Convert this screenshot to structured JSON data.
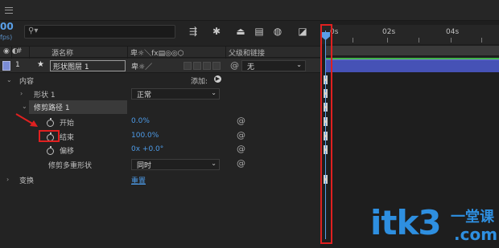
{
  "time": {
    "timecode": "00",
    "fps": "fps)"
  },
  "search": {
    "placeholder": ""
  },
  "header": {
    "col_number": "#",
    "col_source": "源名称",
    "col_parent": "父级和链接"
  },
  "layer": {
    "index": "1",
    "name": "形状图层 1",
    "parent": "无"
  },
  "properties": {
    "contents": "内容",
    "add_label": "添加:",
    "shape": "形状 1",
    "shape_mode": "正常",
    "trim_paths": "修剪路径 1",
    "start_label": "开始",
    "start_value": "0.0%",
    "end_label": "结束",
    "end_value": "100.0%",
    "offset_label": "偏移",
    "offset_value": "0x +0.0°",
    "trim_multiple_label": "修剪多重形状",
    "trim_multiple_value": "同时",
    "transform": "变换",
    "transform_reset": "重置"
  },
  "timeline": {
    "ticks": [
      "0s",
      "02s",
      "04s"
    ]
  },
  "watermark": {
    "brand": "itk3",
    "cn": "一堂课",
    "suffix": ".com"
  },
  "colors": {
    "accent_blue": "#4d9be8",
    "layer_bar": "#4652b6",
    "highlight_red": "#e02020"
  }
}
